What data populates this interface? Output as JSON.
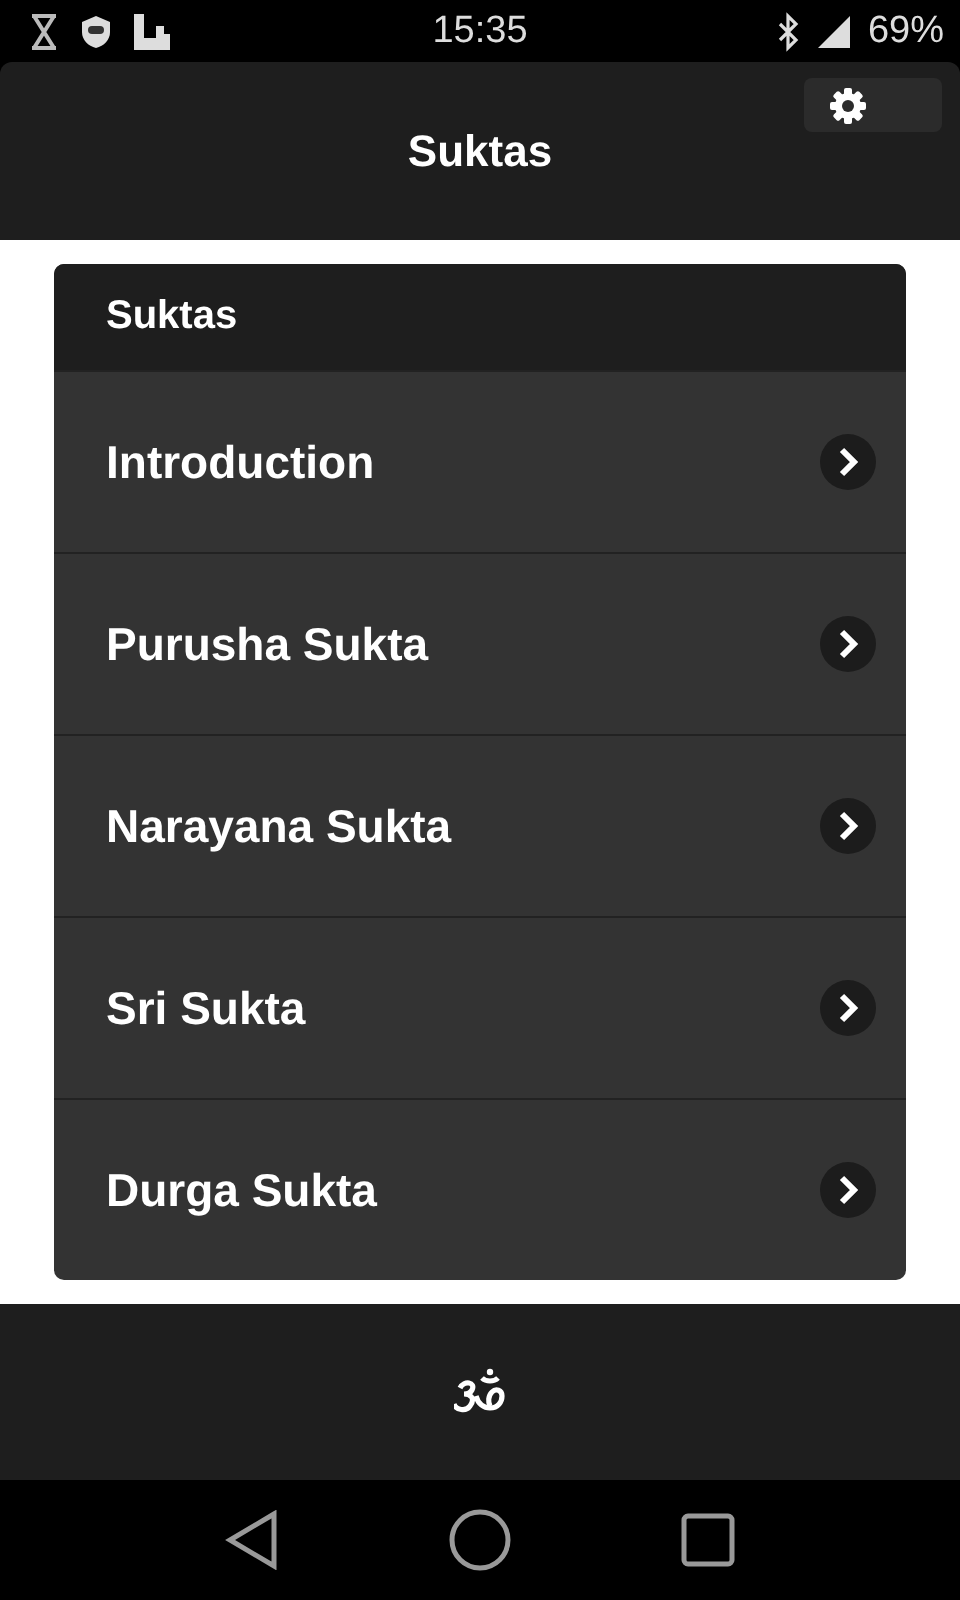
{
  "status_bar": {
    "time": "15:35",
    "battery": "69%"
  },
  "header": {
    "title": "Suktas"
  },
  "list": {
    "heading": "Suktas",
    "items": [
      {
        "label": "Introduction"
      },
      {
        "label": "Purusha Sukta"
      },
      {
        "label": "Narayana Sukta"
      },
      {
        "label": "Sri Sukta"
      },
      {
        "label": "Durga Sukta"
      }
    ]
  }
}
